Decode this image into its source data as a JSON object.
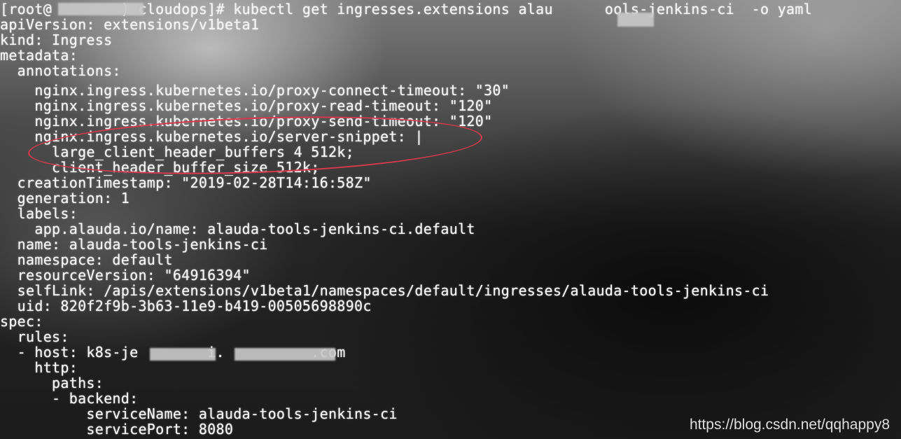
{
  "terminal": {
    "lines": [
      "[root@        ) cloudops]# kubectl get ingresses.extensions alau      ools-jenkins-ci  -o yaml",
      "apiVersion: extensions/v1beta1",
      "kind: Ingress",
      "metadata:",
      "  annotations:",
      "    nginx.ingress.kubernetes.io/proxy-connect-timeout: \"30\"",
      "    nginx.ingress.kubernetes.io/proxy-read-timeout: \"120\"",
      "    nginx.ingress.kubernetes.io/proxy-send-timeout: \"120\"",
      "    nginx.ingress.kubernetes.io/server-snippet: |",
      "      large_client_header_buffers 4 512k;",
      "      client_header_buffer_size 512k;",
      "  creationTimestamp: \"2019-02-28T14:16:58Z\"",
      "  generation: 1",
      "  labels:",
      "    app.alauda.io/name: alauda-tools-jenkins-ci.default",
      "  name: alauda-tools-jenkins-ci",
      "  namespace: default",
      "  resourceVersion: \"64916394\"",
      "  selfLink: /apis/extensions/v1beta1/namespaces/default/ingresses/alauda-tools-jenkins-ci",
      "  uid: 820f2f9b-3b63-11e9-b419-00505698890c",
      "spec:",
      "  rules:",
      "  - host: k8s-je        i.          .com",
      "    http:",
      "      paths:",
      "      - backend:",
      "          serviceName: alauda-tools-jenkins-ci",
      "          servicePort: 8080"
    ]
  },
  "watermark": {
    "text": "https://blog.csdn.net/qqhappy8"
  }
}
